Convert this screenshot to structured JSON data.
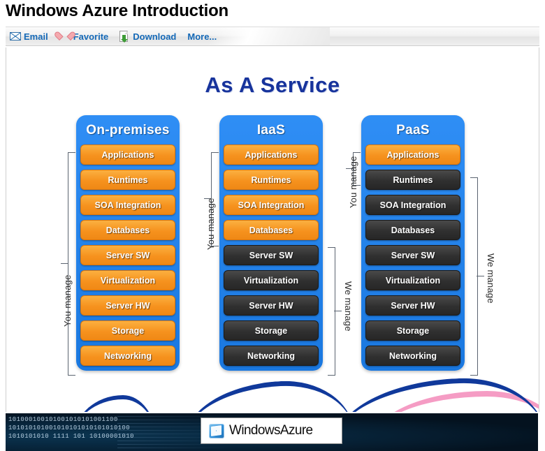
{
  "page": {
    "title": "Windows Azure Introduction"
  },
  "toolbar": {
    "items": [
      {
        "label": "Email",
        "icon": "envelope-icon"
      },
      {
        "label": "Favorite",
        "icon": "heart-icon"
      },
      {
        "label": "Download",
        "icon": "download-icon"
      },
      {
        "label": "More...",
        "icon": "none"
      }
    ]
  },
  "viewer": {
    "cursor_icon": "pointing-hand-cursor",
    "cursor_glyph": "☞"
  },
  "slide": {
    "title": "As A Service",
    "columns": [
      {
        "id": "on-premises",
        "heading": "On-premises",
        "layers": [
          {
            "label": "Applications",
            "style": "orange"
          },
          {
            "label": "Runtimes",
            "style": "orange"
          },
          {
            "label": "SOA Integration",
            "style": "orange"
          },
          {
            "label": "Databases",
            "style": "orange"
          },
          {
            "label": "Server SW",
            "style": "orange"
          },
          {
            "label": "Virtualization",
            "style": "orange"
          },
          {
            "label": "Server HW",
            "style": "orange"
          },
          {
            "label": "Storage",
            "style": "orange"
          },
          {
            "label": "Networking",
            "style": "orange"
          }
        ]
      },
      {
        "id": "iaas",
        "heading": "IaaS",
        "layers": [
          {
            "label": "Applications",
            "style": "orange"
          },
          {
            "label": "Runtimes",
            "style": "orange"
          },
          {
            "label": "SOA Integration",
            "style": "orange"
          },
          {
            "label": "Databases",
            "style": "orange"
          },
          {
            "label": "Server SW",
            "style": "dark"
          },
          {
            "label": "Virtualization",
            "style": "dark"
          },
          {
            "label": "Server HW",
            "style": "dark"
          },
          {
            "label": "Storage",
            "style": "dark"
          },
          {
            "label": "Networking",
            "style": "dark"
          }
        ]
      },
      {
        "id": "paas",
        "heading": "PaaS",
        "layers": [
          {
            "label": "Applications",
            "style": "orange"
          },
          {
            "label": "Runtimes",
            "style": "dark"
          },
          {
            "label": "SOA Integration",
            "style": "dark"
          },
          {
            "label": "Databases",
            "style": "dark"
          },
          {
            "label": "Server SW",
            "style": "dark"
          },
          {
            "label": "Virtualization",
            "style": "dark"
          },
          {
            "label": "Server HW",
            "style": "dark"
          },
          {
            "label": "Storage",
            "style": "dark"
          },
          {
            "label": "Networking",
            "style": "dark"
          }
        ]
      }
    ],
    "annotations": {
      "onprem_you_manage": "You manage",
      "iaas_you_manage": "You manage",
      "iaas_we_manage": "We manage",
      "paas_you_manage": "You manage",
      "paas_we_manage": "We manage"
    },
    "colors": {
      "column_blue": "#1f7fea",
      "layer_orange": "#f6921e",
      "layer_dark": "#303030",
      "title_blue": "#17339c",
      "wave_blue": "#10399b",
      "wave_pink": "#f59cc4"
    }
  },
  "footer": {
    "binary_art": "101000100101001010101001100\n101010101001010101010101010100\n1010101010 1111 101 10100001010",
    "logo": {
      "icon": "windows-flag-icon",
      "word_1": "Windows",
      "word_2": "Azure"
    }
  }
}
